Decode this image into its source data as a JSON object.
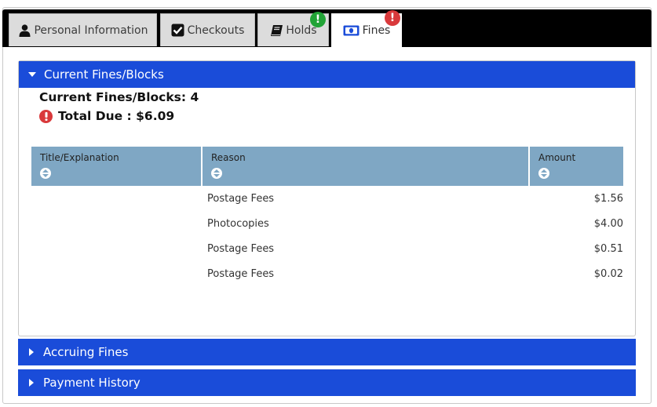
{
  "tabs": [
    {
      "label": "Personal Information",
      "icon": "user-icon"
    },
    {
      "label": "Checkouts",
      "icon": "checkbox-icon"
    },
    {
      "label": "Holds",
      "icon": "book-icon",
      "badge": "!",
      "badge_color": "#21a336"
    },
    {
      "label": "Fines",
      "icon": "money-icon",
      "badge": "!",
      "badge_color": "#d9393b",
      "active": true
    }
  ],
  "current_fines": {
    "header": "Current Fines/Blocks",
    "count_label": "Current Fines/Blocks: 4",
    "total_label": "Total Due : $6.09",
    "columns": [
      "Title/Explanation",
      "Reason",
      "Amount"
    ],
    "rows": [
      {
        "title": "",
        "reason": "Postage Fees",
        "amount": "$1.56"
      },
      {
        "title": "",
        "reason": "Photocopies",
        "amount": "$4.00"
      },
      {
        "title": "",
        "reason": "Postage Fees",
        "amount": "$0.51"
      },
      {
        "title": "",
        "reason": "Postage Fees",
        "amount": "$0.02"
      }
    ]
  },
  "accruing": {
    "header": "Accruing Fines"
  },
  "payment_history": {
    "header": "Payment History"
  },
  "colors": {
    "accent": "#1a4cd9",
    "table_header": "#7fa7c4",
    "alert": "#d9393b",
    "success": "#21a336"
  }
}
